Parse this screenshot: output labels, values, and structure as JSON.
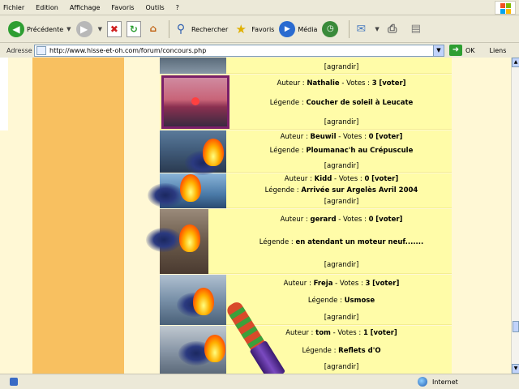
{
  "menu": {
    "items": [
      "Fichier",
      "Edition",
      "Affichage",
      "Favoris",
      "Outils",
      "?"
    ]
  },
  "toolbar": {
    "back_label": "Précédente",
    "search_label": "Rechercher",
    "favorites_label": "Favoris",
    "media_label": "Média"
  },
  "address": {
    "label": "Adresse",
    "url": "http://www.hisse-et-oh.com/forum/concours.php",
    "go_label": "OK",
    "links_label": "Liens"
  },
  "entries": [
    {
      "author_prefix": "Auteur : ",
      "author": "Nathalie",
      "votes_prefix": " - Votes : ",
      "votes": "3",
      "vote_link": "[voter]",
      "caption_prefix": "Légende : ",
      "caption": "Coucher de soleil à Leucate",
      "enlarge": "[agrandir]"
    },
    {
      "author_prefix": "Auteur : ",
      "author": "Beuwil",
      "votes_prefix": " - Votes : ",
      "votes": "0",
      "vote_link": "[voter]",
      "caption_prefix": "Légende : ",
      "caption": "Ploumanac'h au Crépuscule",
      "enlarge": "[agrandir]"
    },
    {
      "author_prefix": "Auteur : ",
      "author": "Kidd",
      "votes_prefix": " - Votes : ",
      "votes": "0",
      "vote_link": "[voter]",
      "caption_prefix": "Légende : ",
      "caption": "Arrivée sur Argelès Avril 2004",
      "enlarge": "[agrandir]"
    },
    {
      "author_prefix": "Auteur : ",
      "author": "gerard",
      "votes_prefix": " - Votes : ",
      "votes": "0",
      "vote_link": "[voter]",
      "caption_prefix": "Légende : ",
      "caption": "en atendant un moteur neuf.......",
      "enlarge": "[agrandir]"
    },
    {
      "author_prefix": "Auteur : ",
      "author": "Freja",
      "votes_prefix": " - Votes : ",
      "votes": "3",
      "vote_link": "[voter]",
      "caption_prefix": "Légende : ",
      "caption": "Usmose",
      "enlarge": "[agrandir]"
    },
    {
      "author_prefix": "Auteur : ",
      "author": "tom",
      "votes_prefix": " - Votes : ",
      "votes": "1",
      "vote_link": "[voter]",
      "caption_prefix": "Légende : ",
      "caption": "Reflets d'O",
      "enlarge": "[agrandir]"
    }
  ],
  "top_enlarge": "[agrandir]",
  "status": {
    "zone": "Internet"
  },
  "colors": {
    "row_bg": "#fffca8",
    "page_bg": "#fff8d5",
    "left_column": "#f8c060",
    "photo_frame": "#7a1f6a"
  }
}
